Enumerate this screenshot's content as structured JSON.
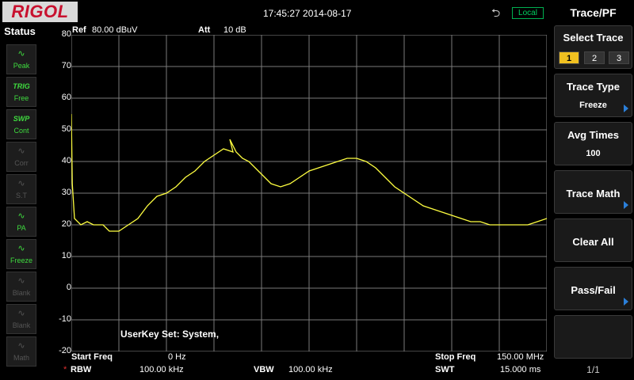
{
  "header": {
    "logo": "RIGOL",
    "datetime": "17:45:27 2014-08-17",
    "usb_icon": "usb-icon",
    "remote_mode": "Local"
  },
  "status": {
    "title": "Status",
    "keys": [
      {
        "icon": "peak-icon",
        "label": "Peak",
        "state": "active"
      },
      {
        "icon": "trig-icon",
        "glyph": "TRIG",
        "label": "Free",
        "state": "active"
      },
      {
        "icon": "swp-icon",
        "glyph": "SWP",
        "label": "Cont",
        "state": "active"
      },
      {
        "icon": "corr-icon",
        "label": "Corr",
        "state": "dim"
      },
      {
        "icon": "st-icon",
        "label": "S.T",
        "state": "dim"
      },
      {
        "icon": "pa-icon",
        "label": "PA",
        "state": "active"
      },
      {
        "icon": "freeze-icon",
        "label": "Freeze",
        "state": "active"
      },
      {
        "icon": "blank-icon",
        "label": "Blank",
        "state": "dim"
      },
      {
        "icon": "blank-icon",
        "label": "Blank",
        "state": "dim"
      },
      {
        "icon": "math-icon",
        "label": "Math",
        "state": "dim"
      }
    ]
  },
  "display": {
    "ref_label": "Ref",
    "ref_value": "80.00 dBuV",
    "att_label": "Att",
    "att_value": "10 dB",
    "userkey": "UserKey Set:   System,",
    "start_freq_label": "Start Freq",
    "start_freq_value": "0 Hz",
    "stop_freq_label": "Stop Freq",
    "stop_freq_value": "150.00 MHz",
    "rbw_mark": "*",
    "rbw_label": "RBW",
    "rbw_value": "100.00 kHz",
    "vbw_label": "VBW",
    "vbw_value": "100.00 kHz",
    "swt_label": "SWT",
    "swt_value": "15.000 ms"
  },
  "chart_data": {
    "type": "line",
    "x_range": [
      0,
      150
    ],
    "ylim": [
      -20,
      80
    ],
    "yticks": [
      "80",
      "70",
      "60",
      "50",
      "40",
      "30",
      "20",
      "10",
      "0",
      "-10",
      "-20"
    ],
    "grid": true,
    "trace_color": "#ffff40",
    "series": [
      {
        "x": [
          0,
          0.3,
          1,
          3,
          5,
          7,
          10,
          12,
          15,
          18,
          21,
          24,
          27,
          30,
          33,
          36,
          39,
          42,
          45,
          48,
          51,
          50,
          52,
          54,
          56,
          58,
          60,
          62,
          63,
          66,
          69,
          72,
          75,
          78,
          81,
          84,
          87,
          90,
          93,
          96,
          99,
          102,
          105,
          108,
          111,
          114,
          117,
          120,
          123,
          126,
          129,
          132,
          135,
          138,
          141,
          144,
          147,
          150
        ],
        "y": [
          55,
          33,
          22,
          20,
          21,
          20,
          20,
          18,
          18,
          20,
          22,
          26,
          29,
          30,
          32,
          35,
          37,
          40,
          42,
          44,
          43,
          47,
          43,
          41,
          40,
          38,
          36,
          34,
          33,
          32,
          33,
          35,
          37,
          38,
          39,
          40,
          41,
          41,
          40,
          38,
          35,
          32,
          30,
          28,
          26,
          25,
          24,
          23,
          22,
          21,
          21,
          20,
          20,
          20,
          20,
          20,
          21,
          22
        ]
      }
    ]
  },
  "panel": {
    "title": "Trace/PF",
    "select_trace": {
      "label": "Select Trace",
      "options": [
        "1",
        "2",
        "3"
      ],
      "selected": "1"
    },
    "trace_type": {
      "label": "Trace Type",
      "value": "Freeze"
    },
    "avg_times": {
      "label": "Avg Times",
      "value": "100"
    },
    "trace_math": {
      "label": "Trace Math"
    },
    "clear_all": {
      "label": "Clear All"
    },
    "pass_fail": {
      "label": "Pass/Fail"
    },
    "page": "1/1"
  },
  "colors": {
    "accent": "#f0c020",
    "arrow": "#2b7fd9",
    "status_active": "#3fdc3f",
    "local": "#00d060"
  }
}
